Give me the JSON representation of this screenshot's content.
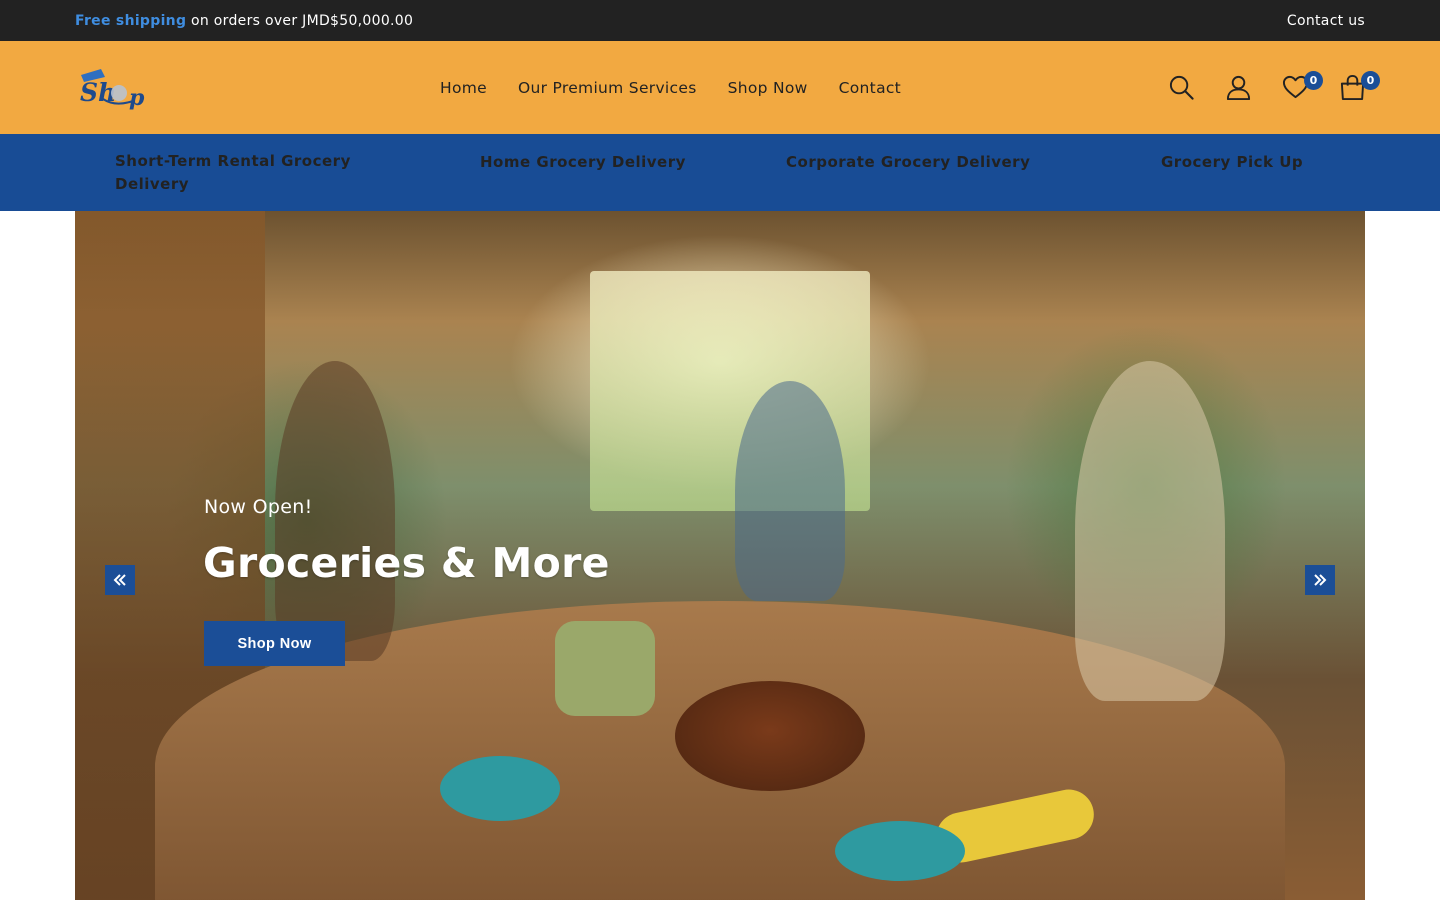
{
  "topbar": {
    "shipping_highlight": "Free shipping",
    "shipping_text": " on orders over JMD$50,000.00",
    "contact_label": "Contact us"
  },
  "header": {
    "logo_text": "Shop",
    "nav": [
      {
        "label": "Home"
      },
      {
        "label": "Our Premium Services"
      },
      {
        "label": "Shop Now"
      },
      {
        "label": "Contact"
      }
    ],
    "icons": {
      "search": "search-icon",
      "account": "user-icon",
      "wishlist": "heart-icon",
      "cart": "shopping-bag-icon"
    },
    "wishlist_count": "0",
    "cart_count": "0"
  },
  "categories": [
    {
      "label": "Short-Term Rental Grocery Delivery"
    },
    {
      "label": "Home Grocery Delivery"
    },
    {
      "label": "Corporate Grocery Delivery"
    },
    {
      "label": "Grocery Pick Up"
    }
  ],
  "hero": {
    "subtitle": "Now Open!",
    "title": "Groceries & More",
    "button_label": "Shop Now",
    "prev_icon": "double-chevron-left-icon",
    "next_icon": "double-chevron-right-icon"
  },
  "colors": {
    "topbar_bg": "#222222",
    "header_bg": "#f2a941",
    "category_bg": "#184c95",
    "accent_blue": "#1b4e97",
    "highlight_blue": "#3f8de0"
  }
}
